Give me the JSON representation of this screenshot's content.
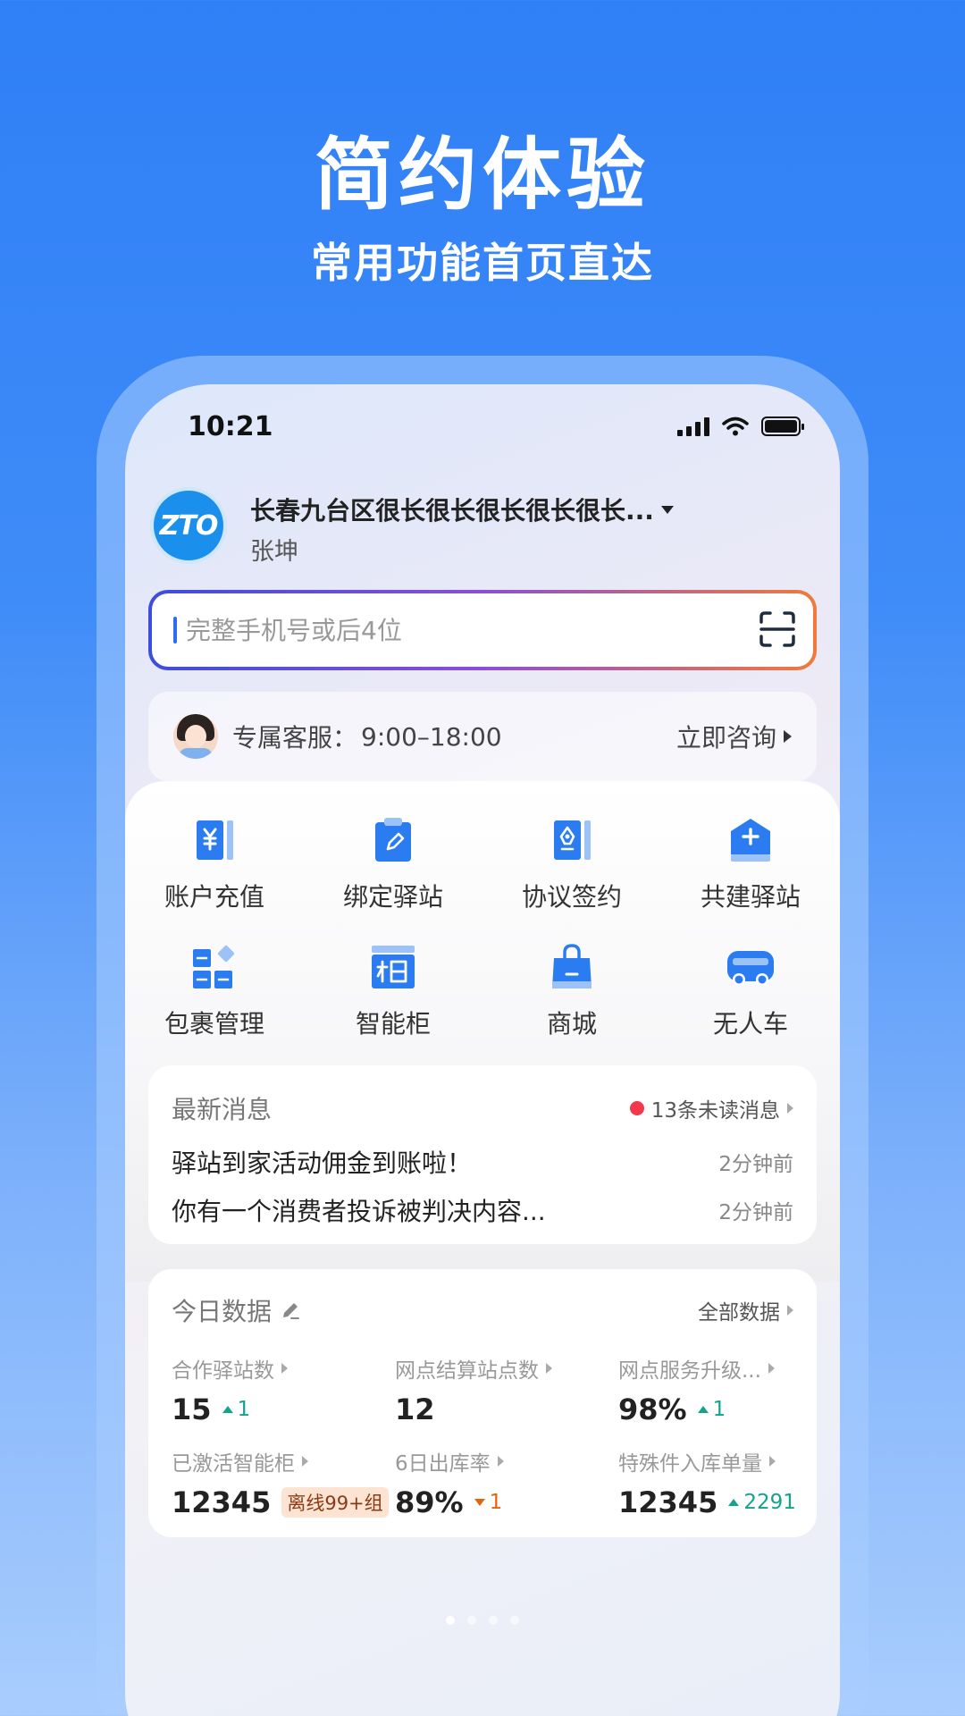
{
  "promo": {
    "headline": "简约体验",
    "subline": "常用功能首页直达"
  },
  "status_bar": {
    "time": "10:21"
  },
  "station": {
    "logo_text": "ZTO",
    "name": "长春九台区很长很长很长很长很长...",
    "user": "张坤"
  },
  "search": {
    "placeholder": "完整手机号或后4位",
    "value": ""
  },
  "service": {
    "label": "专属客服：",
    "hours": "9:00–18:00",
    "consult_label": "立即咨询"
  },
  "quick_actions": [
    {
      "label": "账户充值",
      "icon": "account-recharge-icon"
    },
    {
      "label": "绑定驿站",
      "icon": "bind-station-icon"
    },
    {
      "label": "协议签约",
      "icon": "contract-sign-icon"
    },
    {
      "label": "共建驿站",
      "icon": "co-build-station-icon"
    },
    {
      "label": "包裹管理",
      "icon": "parcel-manage-icon"
    },
    {
      "label": "智能柜",
      "icon": "smart-locker-icon"
    },
    {
      "label": "商城",
      "icon": "mall-bag-icon"
    },
    {
      "label": "无人车",
      "icon": "unmanned-vehicle-icon"
    }
  ],
  "messages": {
    "title": "最新消息",
    "unread": "13条未读消息",
    "items": [
      {
        "text": "驿站到家活动佣金到账啦！",
        "time": "2分钟前"
      },
      {
        "text": "你有一个消费者投诉被判决内容...",
        "time": "2分钟前"
      }
    ]
  },
  "today_data": {
    "title": "今日数据",
    "all_label": "全部数据",
    "stats": [
      {
        "label": "合作驿站数",
        "value": "15",
        "delta": "1",
        "trend": "up"
      },
      {
        "label": "网点结算站点数",
        "value": "12",
        "delta": "",
        "trend": ""
      },
      {
        "label": "网点服务升级...",
        "value": "98%",
        "delta": "1",
        "trend": "up"
      },
      {
        "label": "已激活智能柜",
        "value": "12345",
        "tag": "离线99+组",
        "trend": ""
      },
      {
        "label": "6日出库率",
        "value": "89%",
        "delta": "1",
        "trend": "down"
      },
      {
        "label": "特殊件入库单量",
        "value": "12345",
        "delta": "2291",
        "trend": "up"
      }
    ]
  },
  "colors": {
    "background": "#2f7ff6",
    "primary_icon": "#2b7cf0",
    "up": "#14a38c",
    "down": "#e06412",
    "unread_dot": "#f2384a"
  },
  "pager": {
    "pages": 4,
    "active": 1
  }
}
